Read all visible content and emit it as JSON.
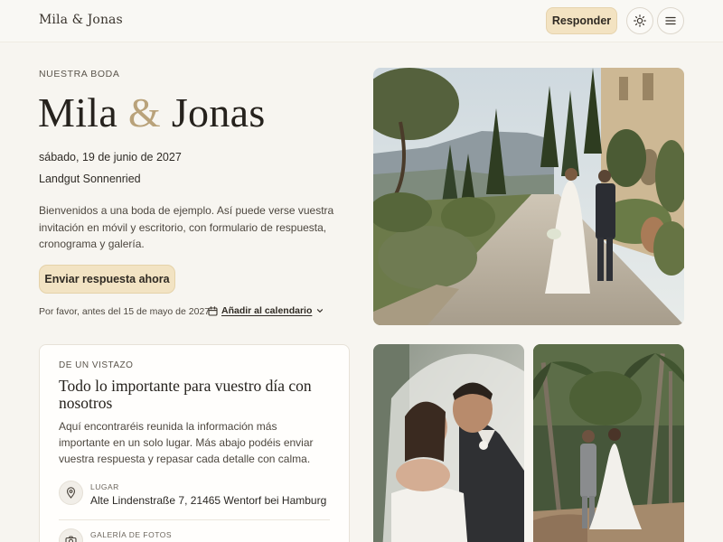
{
  "header": {
    "brand": "Mila & Jonas",
    "respond_label": "Responder",
    "theme_icon": "sun-icon",
    "menu_icon": "hamburger-menu-icon"
  },
  "hero": {
    "eyebrow": "NUESTRA BODA",
    "name_1": "Mila",
    "ampersand": "&",
    "name_2": "Jonas",
    "date": "sábado, 19 de junio de 2027",
    "venue": "Landgut Sonnenried",
    "intro": "Bienvenidos a una boda de ejemplo. Así puede verse vuestra invitación en móvil y escritorio, con formulario de respuesta, cronograma y galería.",
    "cta_label": "Enviar respuesta ahora",
    "deadline": "Por favor, antes del 15 de mayo de 2027",
    "calendar_label": "Añadir al calendario"
  },
  "overview": {
    "eyebrow": "DE UN VISTAZO",
    "title": "Todo lo importante para vuestro día con nosotros",
    "text": "Aquí encontraréis reunida la información más importante en un solo lugar. Más abajo podéis enviar vuestra respuesta y repasar cada detalle con calma.",
    "place_label": "LUGAR",
    "place_value": "Alte Lindenstraße 7, 21465 Wentorf bei Hamburg",
    "gallery_label": "GALERÍA DE FOTOS"
  },
  "colors": {
    "accent": "#f2e3c3",
    "ampersand": "#b9a27a",
    "background": "#f7f5f0"
  }
}
